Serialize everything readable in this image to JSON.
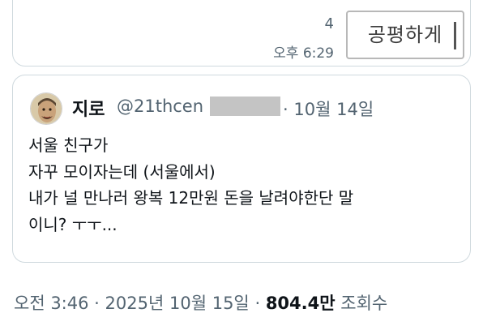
{
  "reply_card": {
    "count": "4",
    "time": "오후 6:29",
    "share_button": "공평하게"
  },
  "quoted_tweet": {
    "author_name": "지로",
    "handle": "@21thcen",
    "date_sep": "·",
    "date": "10월 14일",
    "lines": [
      "서울 친구가",
      "자꾸 모이자는데 (서울에서)",
      "내가 널 만나러 왕복 12만원 돈을 날려야한단 말",
      "이니? ㅜㅜ..."
    ]
  },
  "meta": {
    "time": "오전 3:46",
    "sep1": "·",
    "date": "2025년 10월 15일",
    "sep2": "·",
    "views_count": "804.4만",
    "views_label": "조회수"
  },
  "colors": {
    "secondary_text": "#536471",
    "primary_text": "#0f1419",
    "border": "#cfd9de",
    "redaction": "#c4c4c4"
  }
}
